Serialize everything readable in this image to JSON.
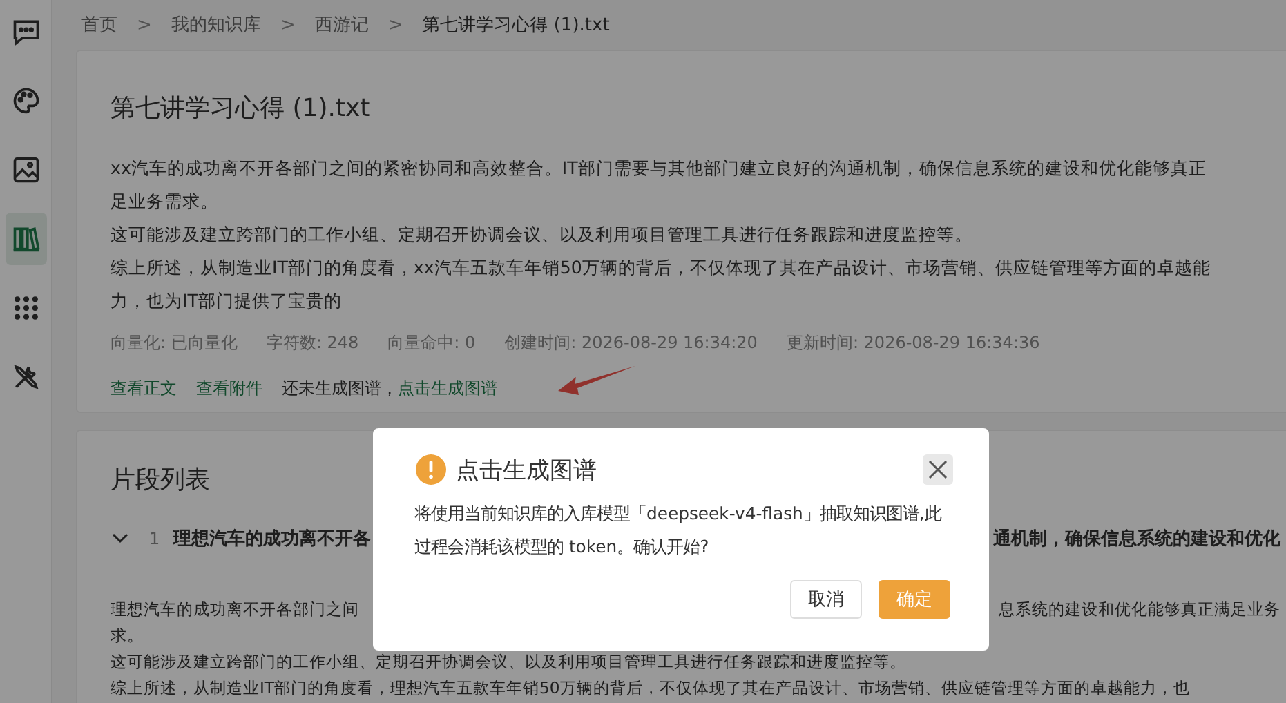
{
  "sidebar": {
    "items": [
      {
        "kind": "chat",
        "selected": false
      },
      {
        "kind": "palette",
        "selected": false
      },
      {
        "kind": "image",
        "selected": false
      },
      {
        "kind": "books",
        "selected": true
      },
      {
        "kind": "apps",
        "selected": false
      },
      {
        "kind": "tools",
        "selected": false
      }
    ]
  },
  "breadcrumb": [
    "首页",
    "我的知识库",
    "西游记",
    "第七讲学习心得 (1).txt"
  ],
  "breadcrumb_separator": ">",
  "document": {
    "title": "第七讲学习心得 (1).txt",
    "lines": [
      "xx汽车的成功离不开各部门之间的紧密协同和高效整合。IT部门需要与其他部门建立良好的沟通机制，确保信息系统的建设和优化能够真正",
      "足业务需求。",
      "这可能涉及建立跨部门的工作小组、定期召开协调会议、以及利用项目管理工具进行任务跟踪和进度监控等。",
      "综上所述，从制造业IT部门的角度看，xx汽车五款车年销50万辆的背后，不仅体现了其在产品设计、市场营销、供应链管理等方面的卓越能",
      "力，也为IT部门提供了宝贵的"
    ],
    "meta": [
      "向量化: 已向量化",
      "字符数: 248",
      "向量命中: 0",
      "创建时间: 2026-08-29 16:34:20",
      "更新时间: 2026-08-29 16:34:36"
    ],
    "links": [
      "查看正文",
      "查看附件"
    ],
    "graph_status": "还未生成图谱，",
    "graph_link": "点击生成图谱"
  },
  "segments": {
    "title": "片段列表",
    "items": [
      {
        "index": "1",
        "expanded": true,
        "title_start": "理想汽车的成功离不开各",
        "title_end": "通机制，确保信息系统的建设和优化",
        "lines": [
          {
            "start": "理想汽车的成功离不开各部门之间",
            "end": "息系统的建设和优化能够真正满足业务"
          },
          {
            "start": "求。"
          },
          {
            "start": "这可能涉及建立跨部门的工作小组、定期召开协调会议、以及利用项目管理工具进行任务跟踪和进度监控等。"
          },
          {
            "start": "综上所述，从制造业IT部门的角度看，理想汽车五款车年销50万辆的背后，不仅体现了其在产品设计、市场营销、供应链管理等方面的卓越能力，也"
          }
        ]
      }
    ]
  },
  "dialog": {
    "title": "点击生成图谱",
    "message": "将使用当前知识库的入库模型「deepseek-v4-flash」抽取知识图谱,此过程会消耗该模型的 token。确认开始?",
    "buttons": [
      {
        "label": "取消",
        "kind": "secondary"
      },
      {
        "label": "确定",
        "kind": "primary"
      }
    ]
  }
}
